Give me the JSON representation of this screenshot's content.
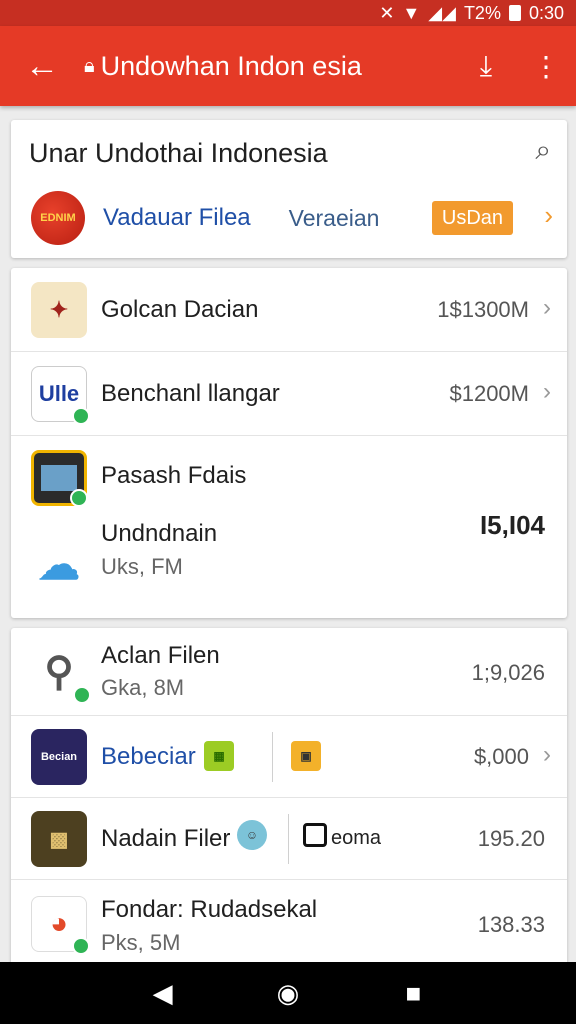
{
  "status_bar": {
    "signal_icon": "nfc-icon",
    "network_text": "T2%",
    "time": "0:30"
  },
  "app_bar": {
    "back_icon": "arrow-left-icon",
    "title": "Undowhan Indon esia",
    "download_icon": "download-icon",
    "more_icon": "more-vertical-icon"
  },
  "header_card": {
    "title": "Unar Undothai Indonesia",
    "logo_text": "EDNIM",
    "link": "Vadauar Filea",
    "version": "Veraeian",
    "button": "UsDan",
    "accent_color": "#f29a2e"
  },
  "list_one": [
    {
      "name": "Golcan Dacian",
      "price": "1$1300M",
      "chevron": "›"
    },
    {
      "name": "Benchanl llangar",
      "price": "$1200M",
      "chevron": "›",
      "icon_text": "Ulle"
    },
    {
      "name": "Pasash Fdais"
    },
    {
      "name": "Undndnain",
      "sub": "Uks, FM",
      "price": "I5,I04"
    }
  ],
  "list_two": [
    {
      "name": "Aclan Filen",
      "sub": "Gka, 8M",
      "price": "1;9,026"
    },
    {
      "name": "Bebeciar",
      "price": "$,000",
      "chevron": "›",
      "icon_text": "Becian"
    },
    {
      "name": "Nadain Filer",
      "extra": "eoma",
      "price": "195.20"
    },
    {
      "name": "Fondar: Rudadsekal",
      "sub": "Pks, 5M",
      "price": "138.33"
    }
  ],
  "nav_bar": {
    "back": "◀",
    "home": "◉",
    "recent": "■"
  }
}
